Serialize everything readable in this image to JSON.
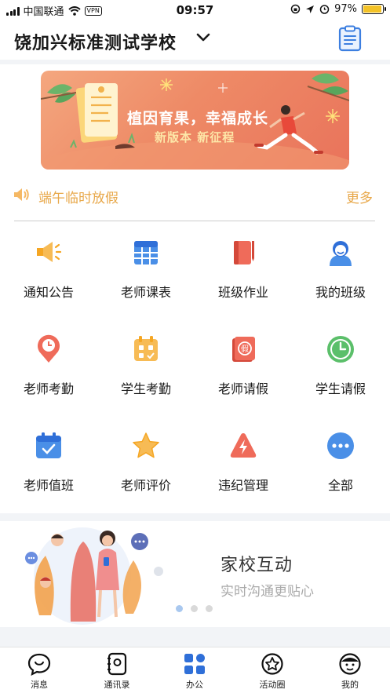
{
  "status_bar": {
    "carrier": "中国联通",
    "vpn": "VPN",
    "time": "09:57",
    "battery": "97%",
    "battery_level": 0.97
  },
  "header": {
    "school_name": "饶加兴标准测试学校"
  },
  "banner": {
    "title": "植因育果，幸福成长",
    "subtitle": "新版本  新征程"
  },
  "notice": {
    "text": "端午临时放假",
    "more_label": "更多"
  },
  "grid": {
    "items": [
      {
        "label": "通知公告",
        "icon": "megaphone-icon"
      },
      {
        "label": "老师课表",
        "icon": "timetable-icon"
      },
      {
        "label": "班级作业",
        "icon": "homework-book-icon"
      },
      {
        "label": "我的班级",
        "icon": "class-person-icon"
      },
      {
        "label": "老师考勤",
        "icon": "clock-pin-icon"
      },
      {
        "label": "学生考勤",
        "icon": "calendar-check-icon"
      },
      {
        "label": "老师请假",
        "icon": "leave-doc-icon"
      },
      {
        "label": "学生请假",
        "icon": "clock-icon"
      },
      {
        "label": "老师值班",
        "icon": "calendar-duty-icon"
      },
      {
        "label": "老师评价",
        "icon": "star-icon"
      },
      {
        "label": "违纪管理",
        "icon": "lightning-triangle-icon"
      },
      {
        "label": "全部",
        "icon": "more-dots-icon"
      }
    ]
  },
  "promo": {
    "title": "家校互动",
    "subtitle": "实时沟通更贴心"
  },
  "tabbar": {
    "items": [
      {
        "label": "消息",
        "icon": "chat-bubble-icon"
      },
      {
        "label": "通讯录",
        "icon": "contacts-book-icon"
      },
      {
        "label": "办公",
        "icon": "office-grid-icon"
      },
      {
        "label": "活动圈",
        "icon": "activity-circle-icon"
      },
      {
        "label": "我的",
        "icon": "profile-face-icon"
      }
    ]
  },
  "colors": {
    "accent": "#e8a84a",
    "active_tab": "#2f6fd8",
    "banner": "#ee8a66"
  }
}
